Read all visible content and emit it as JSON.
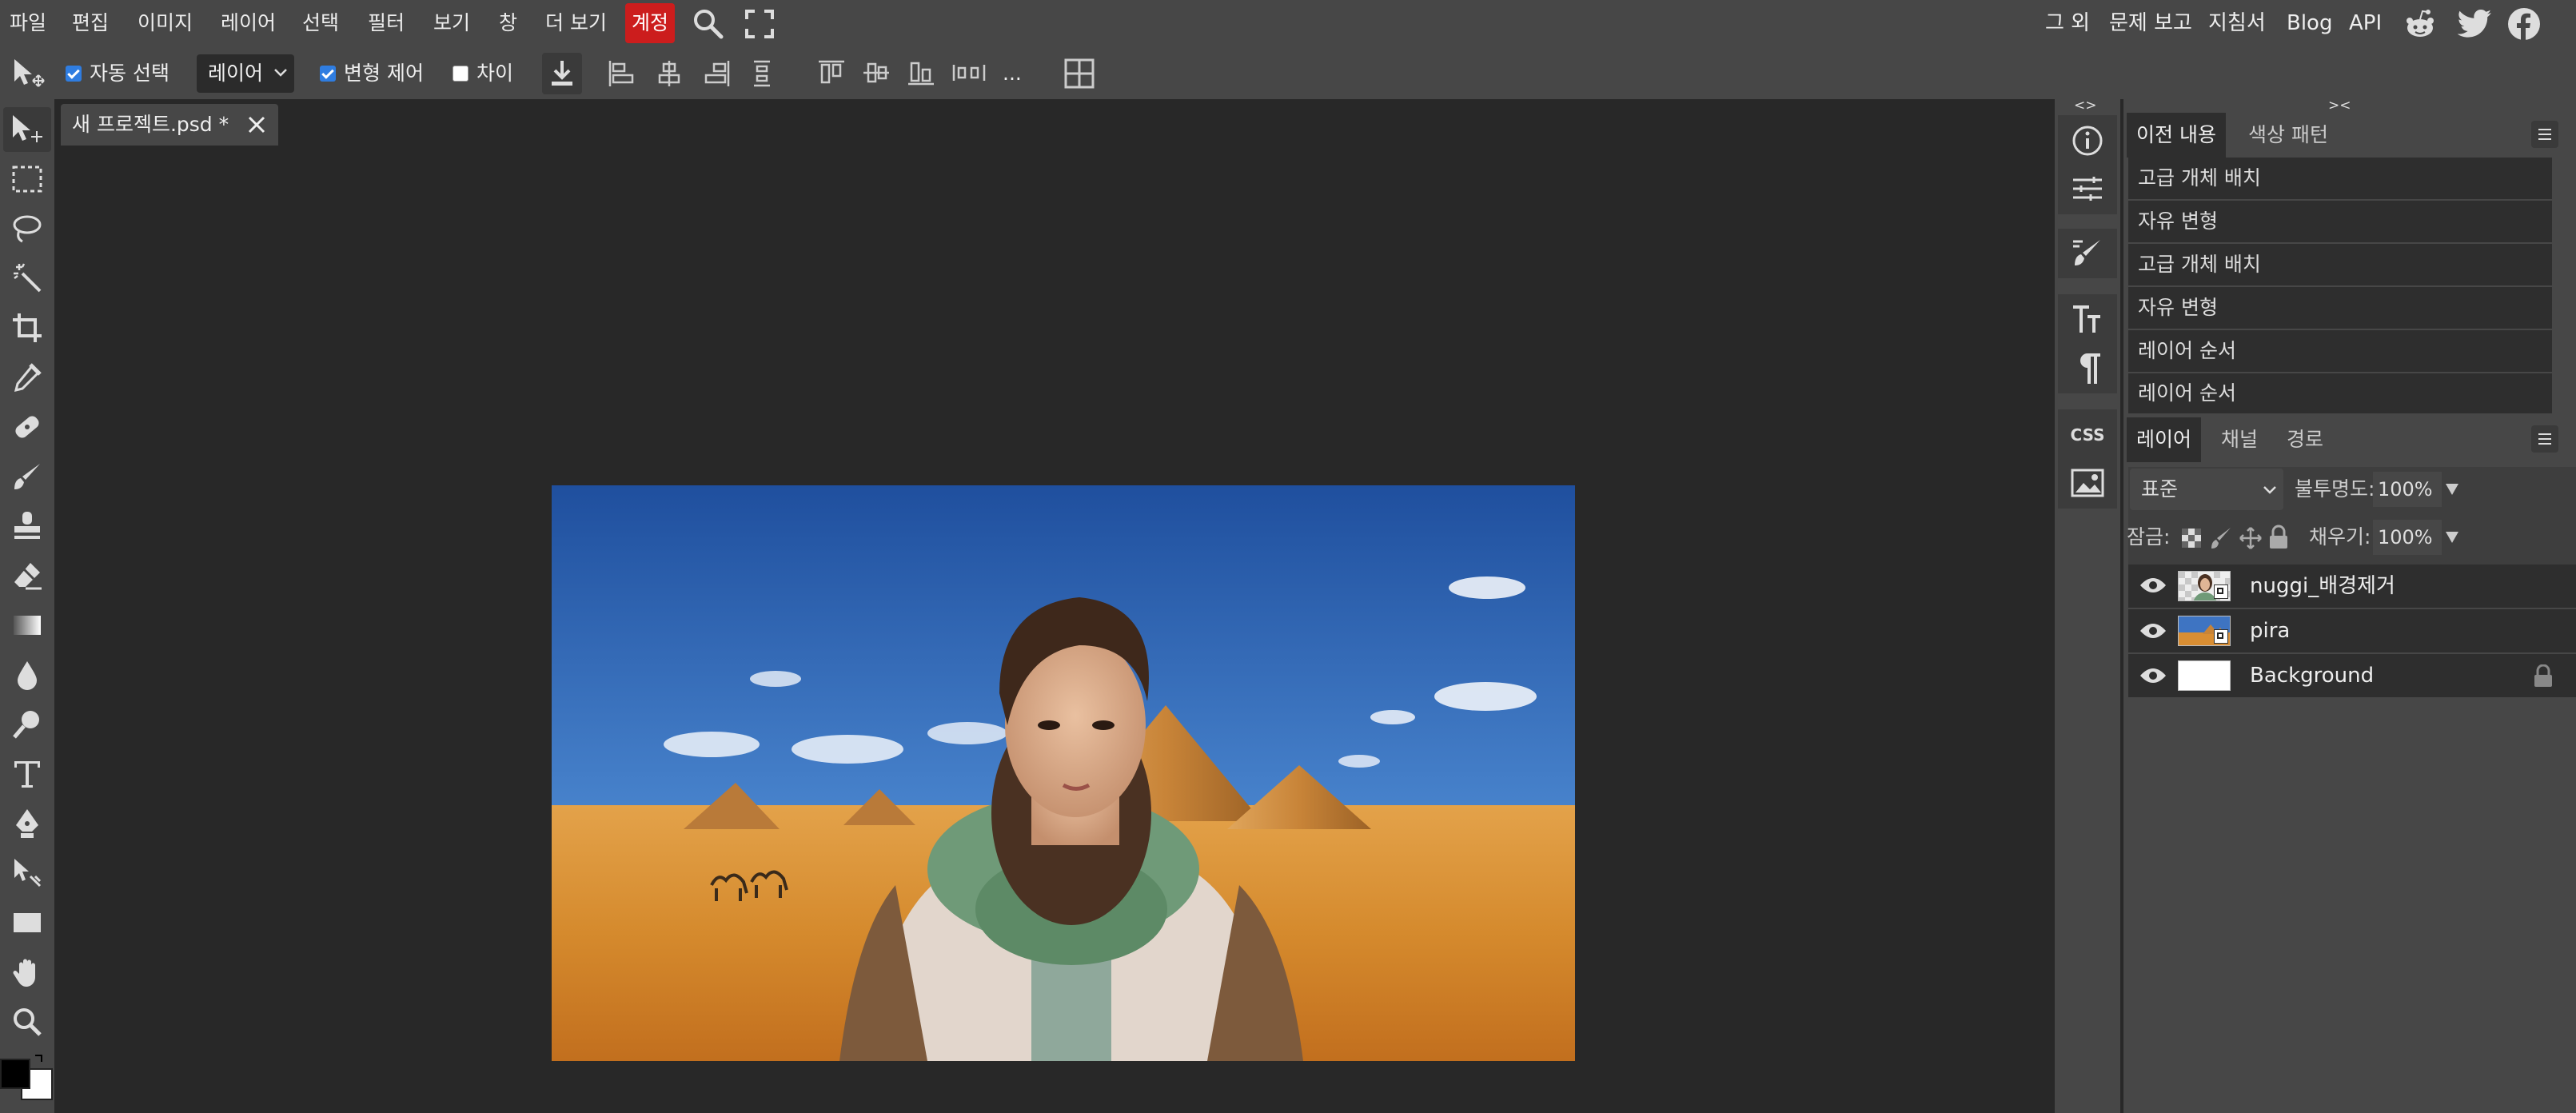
{
  "menubar": {
    "items": [
      "파일",
      "편집",
      "이미지",
      "레이어",
      "선택",
      "필터",
      "보기",
      "창",
      "더 보기"
    ],
    "account": "계정",
    "right_links": [
      "그 외",
      "문제 보고",
      "지침서",
      "Blog",
      "API"
    ],
    "icons": [
      "search-icon",
      "fullscreen-icon",
      "reddit-icon",
      "twitter-icon",
      "facebook-icon"
    ]
  },
  "options": {
    "auto_select_label": "자동 선택",
    "auto_select_checked": true,
    "target_value": "레이어",
    "transform_label": "변형 제어",
    "transform_checked": true,
    "diff_label": "차이",
    "diff_checked": false,
    "more": "..."
  },
  "tabs": {
    "document": "새 프로젝트.psd *"
  },
  "history": {
    "tabs": [
      "이전 내용",
      "색상 패턴"
    ],
    "items": [
      "고급 개체 배치",
      "자유 변형",
      "고급 개체 배치",
      "자유 변형",
      "레이어 순서",
      "레이어 순서"
    ]
  },
  "layers": {
    "tabs": [
      "레이어",
      "채널",
      "경로"
    ],
    "blend_mode": "표준",
    "opacity_label": "불투명도:",
    "opacity": "100%",
    "lock_label": "잠금:",
    "fill_label": "채우기:",
    "fill": "100%",
    "items": [
      {
        "name": "nuggi_배경제거",
        "visible": true,
        "smart": true,
        "locked": false
      },
      {
        "name": "pira",
        "visible": true,
        "smart": true,
        "locked": false
      },
      {
        "name": "Background",
        "visible": true,
        "smart": false,
        "locked": true
      }
    ]
  },
  "side_strip": {
    "css_label": "CSS",
    "collapse_left": "<>",
    "collapse_right": "><"
  },
  "colors": {
    "accent": "#cc1d1d",
    "checkbox": "#2f7de1",
    "chrome": "#474747",
    "workspace": "#282828",
    "panel_row": "#2e2e2e",
    "foreground": "#000000",
    "background": "#ffffff"
  }
}
